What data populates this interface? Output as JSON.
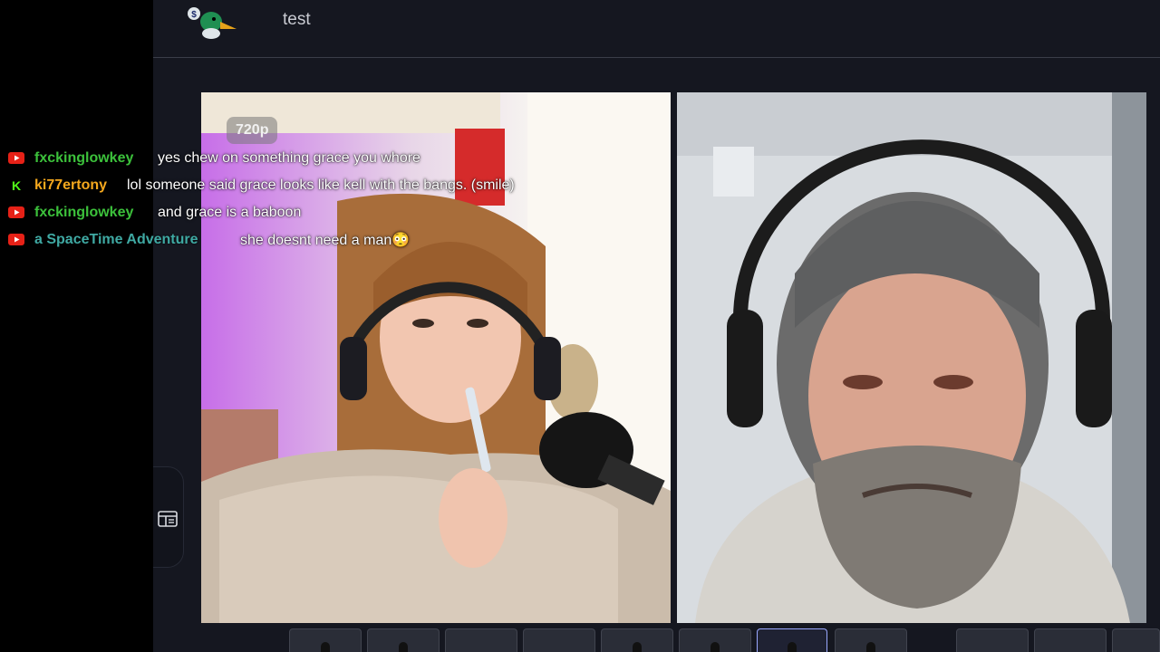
{
  "room": {
    "title": "test"
  },
  "video": {
    "quality_label": "720p"
  },
  "chat": [
    {
      "platform": "youtube",
      "user": "fxckinglowkey",
      "user_color": "#3cc13b",
      "message": "yes chew on something grace you whore"
    },
    {
      "platform": "kick",
      "user": "ki77ertony",
      "user_color": "#f5a81d",
      "message": "lol someone said grace looks like kell with the bangs. (smile)"
    },
    {
      "platform": "youtube",
      "user": "fxckinglowkey",
      "user_color": "#3cc13b",
      "message": "and grace is a baboon"
    },
    {
      "platform": "youtube",
      "user": "a SpaceTime Adventure",
      "user_color": "#3fa9a3",
      "message": "she doesnt need a man😳"
    }
  ],
  "toolbar": {
    "layouts": [
      "single-person-layout",
      "single-person-layout-alt",
      "blank-layout",
      "blank-layout-2",
      "picture-in-picture-layout",
      "two-person-layout",
      "side-by-side-layout",
      "grid-layout"
    ],
    "active_layout_index": 6,
    "actions": [
      "edit-pencil-icon",
      "download-icon",
      "settings-gear-icon"
    ]
  },
  "colors": {
    "app_bg": "#151720",
    "accent": "#9aa8ff",
    "youtube_red": "#e62117",
    "kick_green": "#53fc18"
  }
}
